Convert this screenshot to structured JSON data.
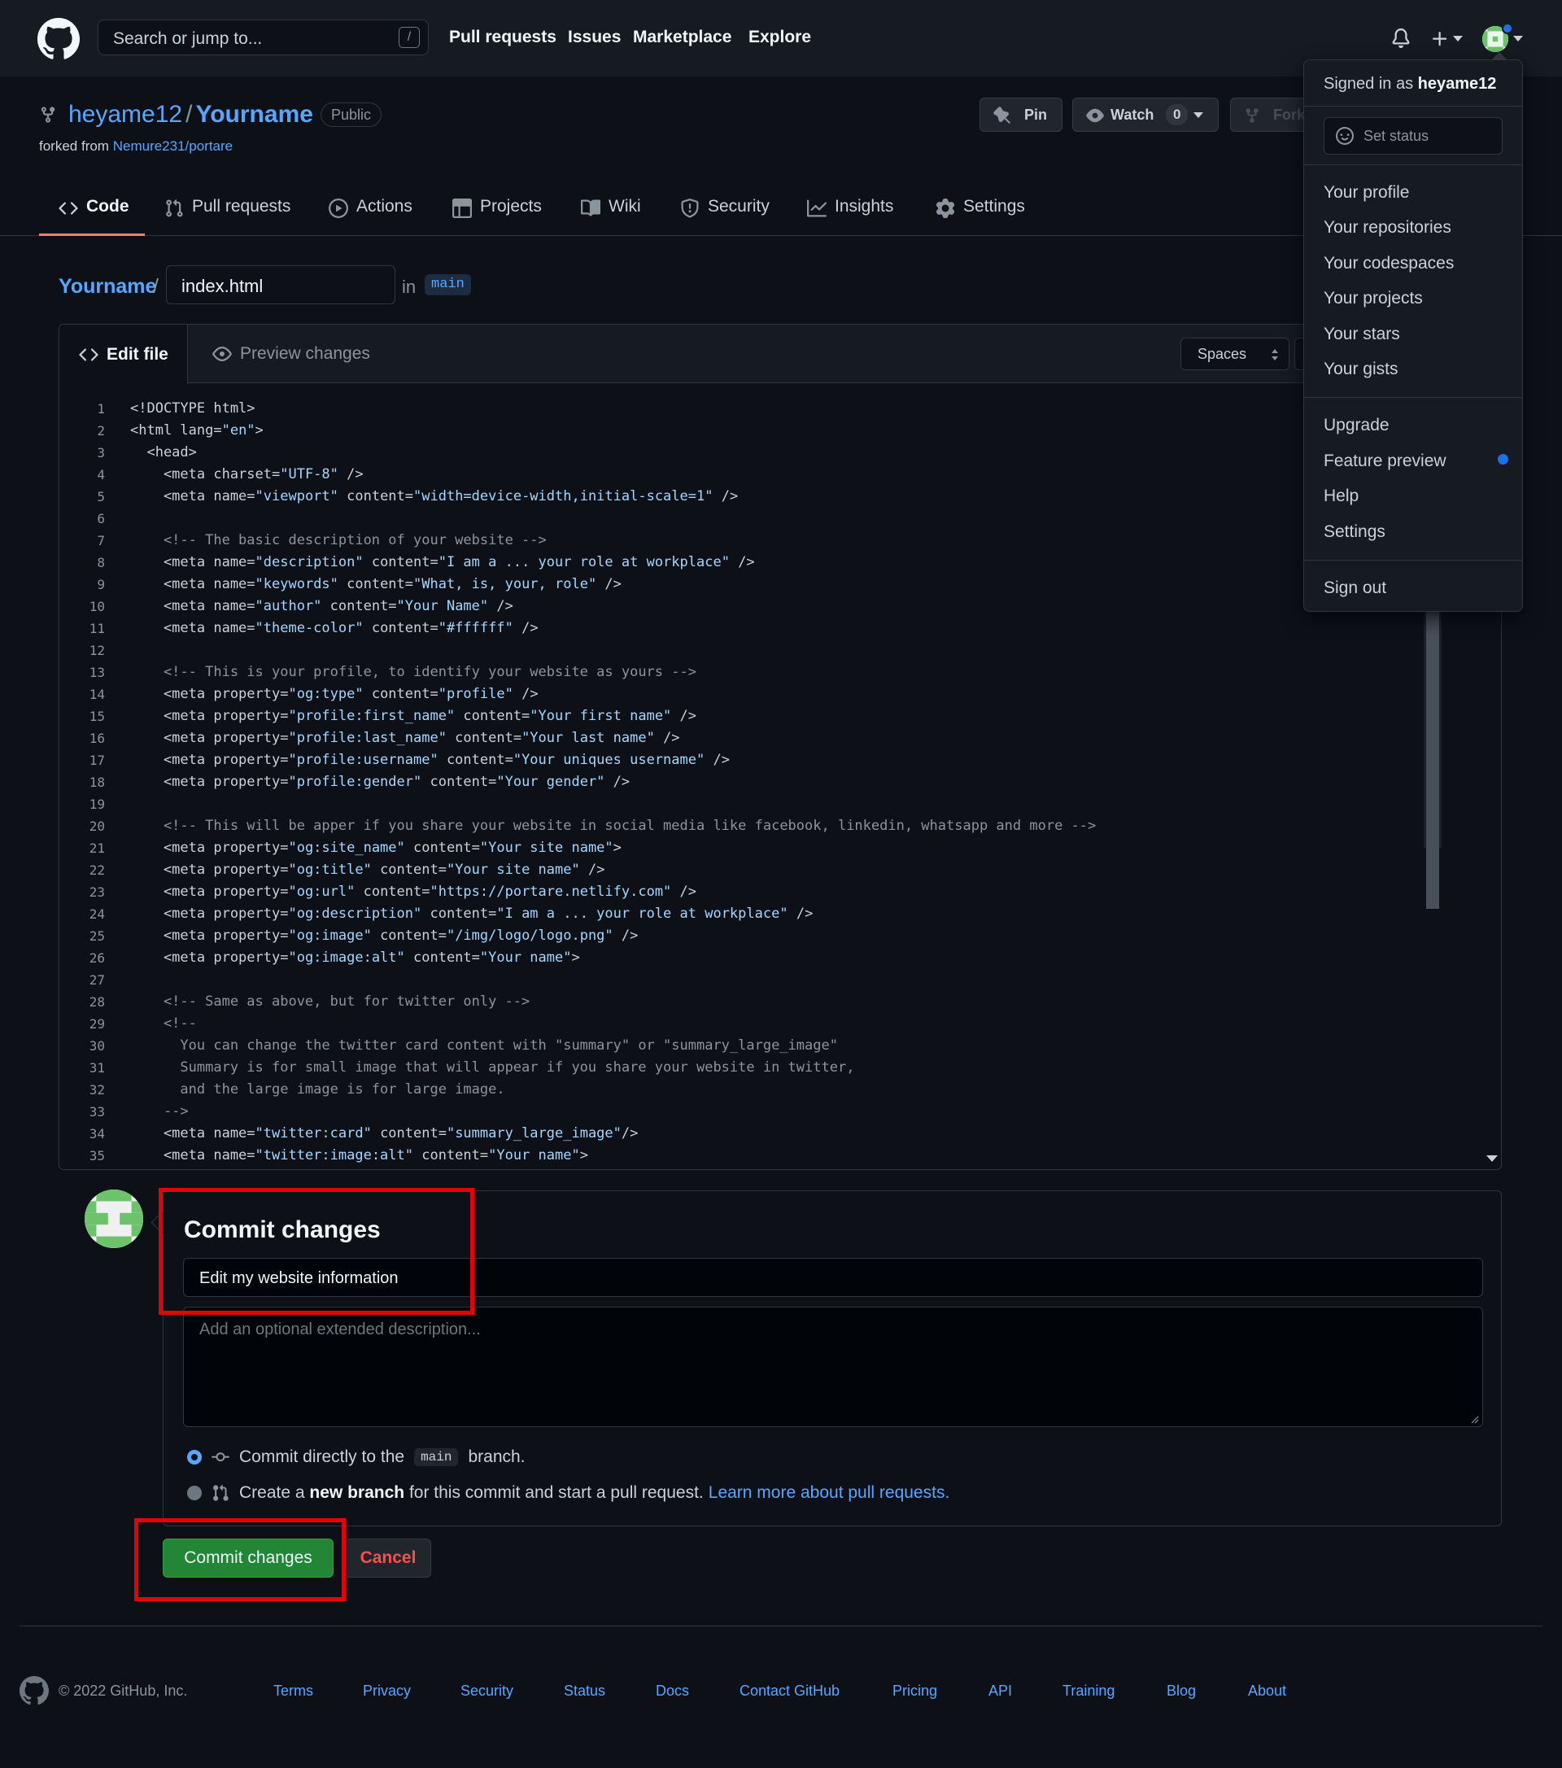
{
  "header": {
    "search_placeholder": "Search or jump to...",
    "search_shortcut": "/",
    "nav": [
      "Pull requests",
      "Issues",
      "Marketplace",
      "Explore"
    ]
  },
  "repo": {
    "owner": "heyame12",
    "name": "Yourname",
    "visibility": "Public",
    "forked_prefix": "forked from",
    "forked_from": "Nemure231/portare",
    "pin_label": "Pin",
    "watch_label": "Watch",
    "watch_count": "0",
    "fork_label": "Fork"
  },
  "tabs": [
    {
      "label": "Code",
      "icon": "code-icon"
    },
    {
      "label": "Pull requests",
      "icon": "pull-request-icon"
    },
    {
      "label": "Actions",
      "icon": "play-icon"
    },
    {
      "label": "Projects",
      "icon": "table-icon"
    },
    {
      "label": "Wiki",
      "icon": "book-icon"
    },
    {
      "label": "Security",
      "icon": "shield-icon"
    },
    {
      "label": "Insights",
      "icon": "graph-icon"
    },
    {
      "label": "Settings",
      "icon": "gear-icon"
    }
  ],
  "breadcrumb": {
    "repo": "Yourname",
    "sep": "/",
    "filename": "index.html",
    "in": "in",
    "branch": "main"
  },
  "editor": {
    "edit_tab": "Edit file",
    "preview_tab": "Preview changes",
    "indent_mode": "Spaces",
    "lines": [
      {
        "n": "1",
        "t": "<!DOCTYPE html>"
      },
      {
        "n": "2",
        "t": "<html lang=\"en\">"
      },
      {
        "n": "3",
        "t": "  <head>"
      },
      {
        "n": "4",
        "t": "    <meta charset=\"UTF-8\" />"
      },
      {
        "n": "5",
        "t": "    <meta name=\"viewport\" content=\"width=device-width,initial-scale=1\" />"
      },
      {
        "n": "6",
        "t": ""
      },
      {
        "n": "7",
        "t": "    <!-- The basic description of your website -->"
      },
      {
        "n": "8",
        "t": "    <meta name=\"description\" content=\"I am a ... your role at workplace\" />"
      },
      {
        "n": "9",
        "t": "    <meta name=\"keywords\" content=\"What, is, your, role\" />"
      },
      {
        "n": "10",
        "t": "    <meta name=\"author\" content=\"Your Name\" />"
      },
      {
        "n": "11",
        "t": "    <meta name=\"theme-color\" content=\"#ffffff\" />"
      },
      {
        "n": "12",
        "t": ""
      },
      {
        "n": "13",
        "t": "    <!-- This is your profile, to identify your website as yours -->"
      },
      {
        "n": "14",
        "t": "    <meta property=\"og:type\" content=\"profile\" />"
      },
      {
        "n": "15",
        "t": "    <meta property=\"profile:first_name\" content=\"Your first name\" />"
      },
      {
        "n": "16",
        "t": "    <meta property=\"profile:last_name\" content=\"Your last name\" />"
      },
      {
        "n": "17",
        "t": "    <meta property=\"profile:username\" content=\"Your uniques username\" />"
      },
      {
        "n": "18",
        "t": "    <meta property=\"profile:gender\" content=\"Your gender\" />"
      },
      {
        "n": "19",
        "t": ""
      },
      {
        "n": "20",
        "t": "    <!-- This will be apper if you share your website in social media like facebook, linkedin, whatsapp and more -->"
      },
      {
        "n": "21",
        "t": "    <meta property=\"og:site_name\" content=\"Your site name\">"
      },
      {
        "n": "22",
        "t": "    <meta property=\"og:title\" content=\"Your site name\" />"
      },
      {
        "n": "23",
        "t": "    <meta property=\"og:url\" content=\"https://portare.netlify.com\" />"
      },
      {
        "n": "24",
        "t": "    <meta property=\"og:description\" content=\"I am a ... your role at workplace\" />"
      },
      {
        "n": "25",
        "t": "    <meta property=\"og:image\" content=\"/img/logo/logo.png\" />"
      },
      {
        "n": "26",
        "t": "    <meta property=\"og:image:alt\" content=\"Your name\">"
      },
      {
        "n": "27",
        "t": ""
      },
      {
        "n": "28",
        "t": "    <!-- Same as above, but for twitter only -->"
      },
      {
        "n": "29",
        "t": "    <!--"
      },
      {
        "n": "30",
        "t": "      You can change the twitter card content with \"summary\" or \"summary_large_image\""
      },
      {
        "n": "31",
        "t": "      Summary is for small image that will appear if you share your website in twitter,"
      },
      {
        "n": "32",
        "t": "      and the large image is for large image."
      },
      {
        "n": "33",
        "t": "    -->"
      },
      {
        "n": "34",
        "t": "    <meta name=\"twitter:card\" content=\"summary_large_image\"/>"
      },
      {
        "n": "35",
        "t": "    <meta name=\"twitter:image:alt\" content=\"Your name\">"
      }
    ]
  },
  "dropdown": {
    "signed_in_prefix": "Signed in as",
    "username": "heyame12",
    "set_status": "Set status",
    "items_a": [
      "Your profile",
      "Your repositories",
      "Your codespaces",
      "Your projects",
      "Your stars",
      "Your gists"
    ],
    "items_b": [
      "Upgrade",
      "Feature preview",
      "Help",
      "Settings"
    ],
    "sign_out": "Sign out"
  },
  "commit": {
    "title": "Commit changes",
    "summary_value": "Edit my website information",
    "description_placeholder": "Add an optional extended description...",
    "option_direct_pre": "Commit directly to the",
    "option_direct_branch": "main",
    "option_direct_post": "branch.",
    "option_new_pre": "Create a",
    "option_new_bold": "new branch",
    "option_new_post": "for this commit and start a pull request.",
    "option_new_link": "Learn more about pull requests.",
    "submit_label": "Commit changes",
    "cancel_label": "Cancel"
  },
  "footer": {
    "copyright": "© 2022 GitHub, Inc.",
    "links": [
      "Terms",
      "Privacy",
      "Security",
      "Status",
      "Docs",
      "Contact GitHub",
      "Pricing",
      "API",
      "Training",
      "Blog",
      "About"
    ]
  },
  "colors": {
    "background": "#0d1117",
    "header": "#161b22",
    "link": "#58a6ff",
    "primary_button": "#238636",
    "danger": "#f85149",
    "highlight_box": "#e5000a"
  }
}
